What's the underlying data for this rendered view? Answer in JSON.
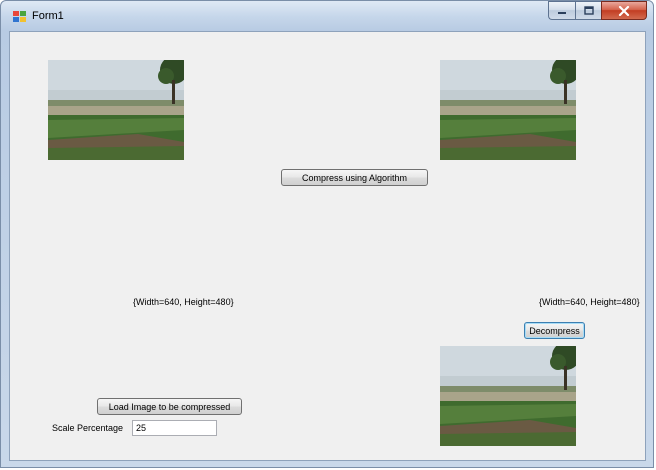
{
  "window": {
    "title": "Form1",
    "app_icon": "winforms-app-icon",
    "controls": {
      "minimize_icon": "minimize-icon",
      "maximize_icon": "maximize-icon",
      "close_icon": "close-icon"
    }
  },
  "form": {
    "compress_button": "Compress using Algorithm",
    "original_size_label": "{Width=640, Height=480}",
    "compressed_size_label": "{Width=640, Height=480}",
    "decompress_button": "Decompress",
    "load_button": "Load Image to be compressed",
    "scale_label": "Scale Percentage",
    "scale_value": "25"
  },
  "colors": {
    "form_background": "#f0f0f0",
    "close_button": "#c23d22",
    "focus_border": "#3c7fb1"
  }
}
